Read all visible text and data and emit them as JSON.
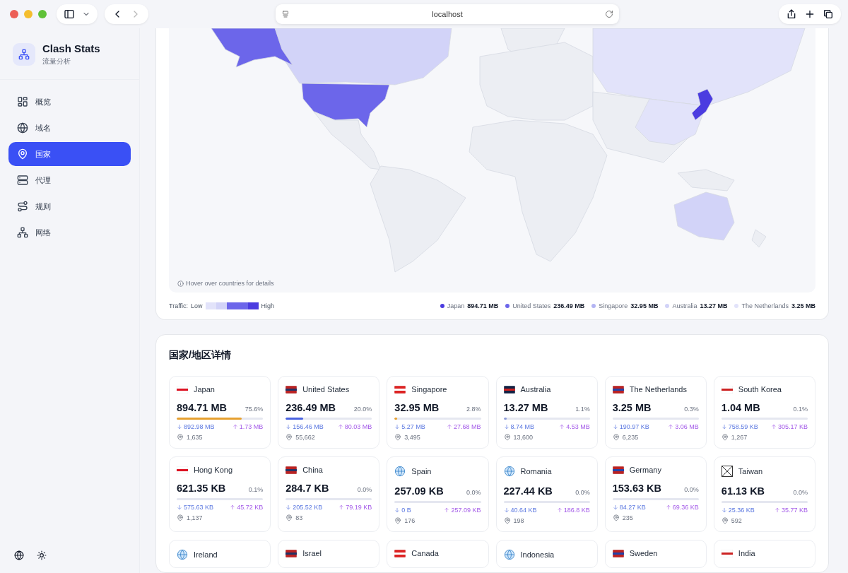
{
  "browser": {
    "address": "localhost"
  },
  "sidebar": {
    "app_title": "Clash Stats",
    "app_subtitle": "流量分析",
    "items": [
      {
        "label": "概览",
        "kind": "overview",
        "selected": false
      },
      {
        "label": "域名",
        "kind": "globe",
        "selected": false
      },
      {
        "label": "国家",
        "kind": "pin",
        "selected": true
      },
      {
        "label": "代理",
        "kind": "server",
        "selected": false
      },
      {
        "label": "规则",
        "kind": "route",
        "selected": false
      },
      {
        "label": "网络",
        "kind": "network",
        "selected": false
      }
    ]
  },
  "map": {
    "hint": "Hover over countries for details",
    "scale_label": "Traffic:",
    "low_label": "Low",
    "high_label": "High",
    "legend": [
      {
        "name": "Japan",
        "value": "894.71 MB",
        "color": "#4b3ce0"
      },
      {
        "name": "United States",
        "value": "236.49 MB",
        "color": "#6c66ea"
      },
      {
        "name": "Singapore",
        "value": "32.95 MB",
        "color": "#b3b4f3"
      },
      {
        "name": "Australia",
        "value": "13.27 MB",
        "color": "#d2d3f8"
      },
      {
        "name": "The Netherlands",
        "value": "3.25 MB",
        "color": "#e2e3fa"
      }
    ]
  },
  "details": {
    "title": "国家/地区详情",
    "countries": [
      {
        "name": "Japan",
        "kind": "flag",
        "total": "894.71 MB",
        "share": "75.6%",
        "level": 0.756,
        "color": "#e6a030",
        "down": "892.98 MB",
        "up": "1.73 MB",
        "connections": "1,635"
      },
      {
        "name": "United States",
        "kind": "flag",
        "total": "236.49 MB",
        "share": "20.0%",
        "level": 0.2,
        "color": "#4a62e0",
        "down": "156.46 MB",
        "up": "80.03 MB",
        "connections": "55,662"
      },
      {
        "name": "Singapore",
        "kind": "flag",
        "total": "32.95 MB",
        "share": "2.8%",
        "level": 0.028,
        "color": "#e6a030",
        "down": "5.27 MB",
        "up": "27.68 MB",
        "connections": "3,495"
      },
      {
        "name": "Australia",
        "kind": "flag",
        "total": "13.27 MB",
        "share": "1.1%",
        "level": 0.011,
        "color": "#8d9bd8",
        "down": "8.74 MB",
        "up": "4.53 MB",
        "connections": "13,600"
      },
      {
        "name": "The Netherlands",
        "kind": "flag",
        "total": "3.25 MB",
        "share": "0.3%",
        "down": "190.97 KB",
        "up": "3.06 MB",
        "connections": "6,235"
      },
      {
        "name": "South Korea",
        "kind": "flag",
        "total": "1.04 MB",
        "share": "0.1%",
        "down": "758.59 KB",
        "up": "305.17 KB",
        "connections": "1,267"
      },
      {
        "name": "Hong Kong",
        "kind": "flag",
        "total": "621.35 KB",
        "share": "0.1%",
        "down": "575.63 KB",
        "up": "45.72 KB",
        "connections": "1,137"
      },
      {
        "name": "China",
        "kind": "flag",
        "total": "284.7 KB",
        "share": "0.0%",
        "down": "205.52 KB",
        "up": "79.19 KB",
        "connections": "83"
      },
      {
        "name": "Spain",
        "kind": "globe",
        "total": "257.09 KB",
        "share": "0.0%",
        "down": "0 B",
        "up": "257.09 KB",
        "connections": "176"
      },
      {
        "name": "Romania",
        "kind": "globe",
        "total": "227.44 KB",
        "share": "0.0%",
        "down": "40.64 KB",
        "up": "186.8 KB",
        "connections": "198"
      },
      {
        "name": "Germany",
        "kind": "flag",
        "total": "153.63 KB",
        "share": "0.0%",
        "down": "84.27 KB",
        "up": "69.36 KB",
        "connections": "235"
      },
      {
        "name": "Taiwan",
        "kind": "missing",
        "total": "61.13 KB",
        "share": "0.0%",
        "down": "25.36 KB",
        "up": "35.77 KB",
        "connections": "592"
      },
      {
        "name": "Ireland",
        "kind": "globe"
      },
      {
        "name": "Israel",
        "kind": "flag"
      },
      {
        "name": "Canada",
        "kind": "flag"
      },
      {
        "name": "Indonesia",
        "kind": "globe"
      },
      {
        "name": "Sweden",
        "kind": "flag"
      },
      {
        "name": "India",
        "kind": "flag"
      }
    ]
  }
}
